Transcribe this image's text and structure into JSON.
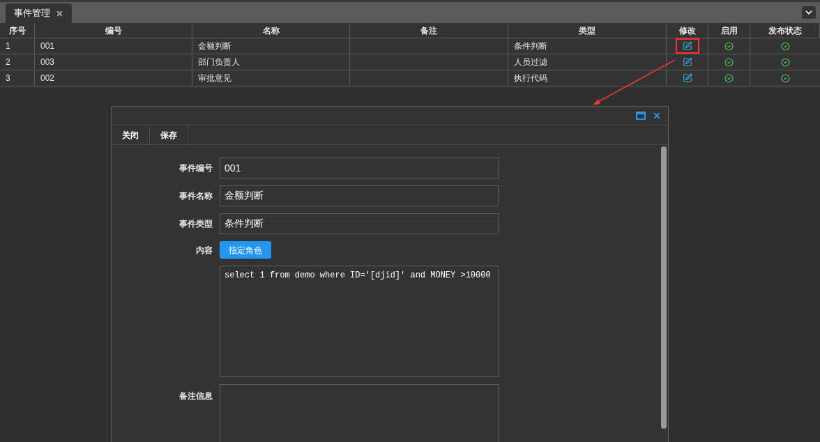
{
  "tabs": [
    {
      "label": "事件管理",
      "selected": true
    }
  ],
  "table": {
    "columns": [
      "序号",
      "编号",
      "名称",
      "备注",
      "类型",
      "修改",
      "启用",
      "发布状态"
    ],
    "rows": [
      {
        "index": "1",
        "code": "001",
        "name": "金额判断",
        "type": "条件判断",
        "highlighted": true,
        "enabled": true,
        "published": true
      },
      {
        "index": "2",
        "code": "003",
        "name": "部门负责人",
        "type": "人员过滤",
        "highlighted": false,
        "enabled": true,
        "published": true
      },
      {
        "index": "3",
        "code": "002",
        "name": "审批意见",
        "type": "执行代码",
        "highlighted": false,
        "enabled": true,
        "published": true
      }
    ]
  },
  "dialog": {
    "toolbar": [
      "关闭",
      "保存"
    ],
    "fields": [
      {
        "kind": "input",
        "label": "事件编号",
        "value": "001"
      },
      {
        "kind": "input",
        "label": "事件名称",
        "value": "金额判断"
      },
      {
        "kind": "input",
        "label": "事件类型",
        "value": "条件判断"
      },
      {
        "kind": "button",
        "label": "内容",
        "button": "指定角色"
      },
      {
        "kind": "code",
        "value": "select 1 from demo where ID='[djid]' and MONEY >10000"
      },
      {
        "kind": "textarea",
        "label": "备注信息"
      }
    ]
  }
}
